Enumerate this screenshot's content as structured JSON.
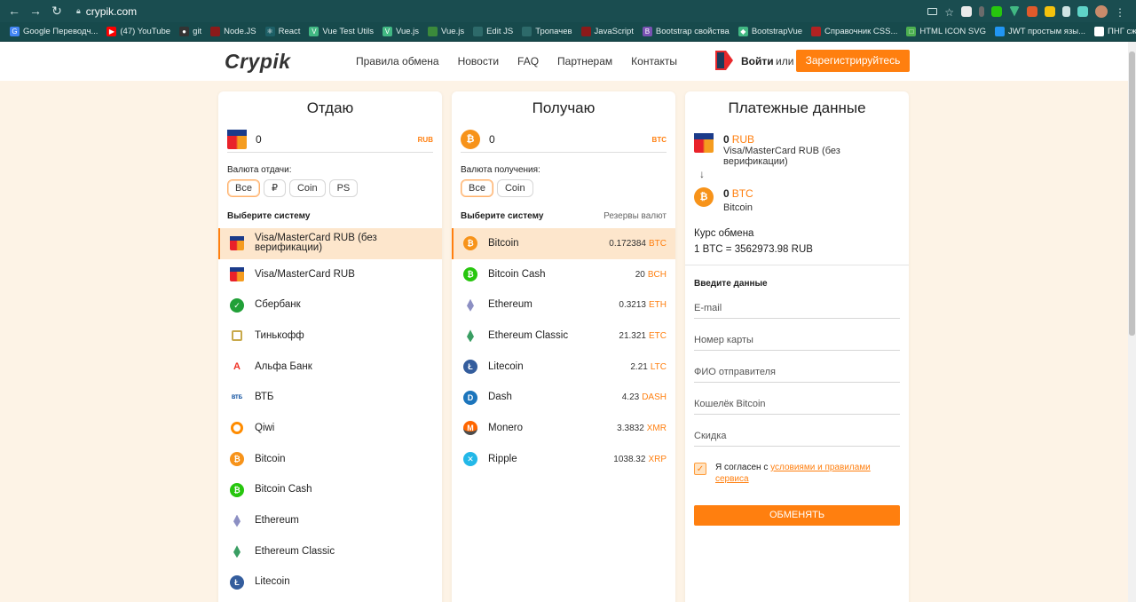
{
  "browser": {
    "url": "crypik.com",
    "bookmarks": [
      {
        "label": "Google Переводч...",
        "color": "#4285f4",
        "icon": "G"
      },
      {
        "label": "(47) YouTube",
        "color": "#ff0000",
        "icon": "▶"
      },
      {
        "label": "git",
        "color": "#333333",
        "icon": "●"
      },
      {
        "label": "Node.JS",
        "color": "#8b1a1a",
        "icon": ""
      },
      {
        "label": "React",
        "color": "#1d5f66",
        "icon": "⚛"
      },
      {
        "label": "Vue Test Utils",
        "color": "#41b883",
        "icon": "V"
      },
      {
        "label": "Vue.js",
        "color": "#41b883",
        "icon": "V"
      },
      {
        "label": "Vue.js",
        "color": "#3b8a3b",
        "icon": ""
      },
      {
        "label": "Edit JS",
        "color": "#2d6a6a",
        "icon": ""
      },
      {
        "label": "Тропачев",
        "color": "#2d6a6a",
        "icon": ""
      },
      {
        "label": "JavaScript",
        "color": "#8b1a1a",
        "icon": ""
      },
      {
        "label": "Bootstrap свойства",
        "color": "#7952b3",
        "icon": "B"
      },
      {
        "label": "BootstrapVue",
        "color": "#41b883",
        "icon": "◆"
      },
      {
        "label": "Справочник CSS...",
        "color": "#b22222",
        "icon": ""
      },
      {
        "label": "HTML ICON SVG",
        "color": "#4caf50",
        "icon": "□"
      },
      {
        "label": "JWT простым язы...",
        "color": "#2196f3",
        "icon": ""
      },
      {
        "label": "ПНГ сжимает в Jpg",
        "color": "#ffffff",
        "icon": ""
      }
    ]
  },
  "header": {
    "logo": "Crypik",
    "menu": [
      "Правила обмена",
      "Новости",
      "FAQ",
      "Партнерам",
      "Контакты"
    ],
    "login": "Войти",
    "or": "или",
    "register": "Зарегистрируйтесь"
  },
  "give": {
    "title": "Отдаю",
    "amount": "0",
    "currency": "RUB",
    "currency_label": "Валюта отдачи:",
    "filters": [
      "Все",
      "₽",
      "Coin",
      "PS"
    ],
    "systems_label": "Выберите систему",
    "items": [
      {
        "name": "Visa/MasterCard RUB (без верификации)",
        "icon": "visa-mastercard-icon"
      },
      {
        "name": "Visa/MasterCard RUB",
        "icon": "visa-mastercard-icon"
      },
      {
        "name": "Сбербанк",
        "icon": "sberbank-icon"
      },
      {
        "name": "Тинькофф",
        "icon": "tinkoff-icon"
      },
      {
        "name": "Альфа Банк",
        "icon": "alfa-bank-icon"
      },
      {
        "name": "ВТБ",
        "icon": "vtb-icon"
      },
      {
        "name": "Qiwi",
        "icon": "qiwi-icon"
      },
      {
        "name": "Bitcoin",
        "icon": "bitcoin-icon"
      },
      {
        "name": "Bitcoin Cash",
        "icon": "bitcoin-cash-icon"
      },
      {
        "name": "Ethereum",
        "icon": "ethereum-icon"
      },
      {
        "name": "Ethereum Classic",
        "icon": "ethereum-classic-icon"
      },
      {
        "name": "Litecoin",
        "icon": "litecoin-icon"
      }
    ]
  },
  "get": {
    "title": "Получаю",
    "amount": "0",
    "currency": "BTC",
    "currency_label": "Валюта получения:",
    "filters": [
      "Все",
      "Coin"
    ],
    "systems_label": "Выберите систему",
    "reserves_label": "Резервы валют",
    "items": [
      {
        "name": "Bitcoin",
        "reserve": "0.172384",
        "code": "BTC",
        "icon": "bitcoin-icon"
      },
      {
        "name": "Bitcoin Cash",
        "reserve": "20",
        "code": "BCH",
        "icon": "bitcoin-cash-icon"
      },
      {
        "name": "Ethereum",
        "reserve": "0.3213",
        "code": "ETH",
        "icon": "ethereum-icon"
      },
      {
        "name": "Ethereum Classic",
        "reserve": "21.321",
        "code": "ETC",
        "icon": "ethereum-classic-icon"
      },
      {
        "name": "Litecoin",
        "reserve": "2.21",
        "code": "LTC",
        "icon": "litecoin-icon"
      },
      {
        "name": "Dash",
        "reserve": "4.23",
        "code": "DASH",
        "icon": "dash-icon"
      },
      {
        "name": "Monero",
        "reserve": "3.3832",
        "code": "XMR",
        "icon": "monero-icon"
      },
      {
        "name": "Ripple",
        "reserve": "1038.32",
        "code": "XRP",
        "icon": "ripple-icon"
      }
    ]
  },
  "payment": {
    "title": "Платежные данные",
    "give_amount": "0",
    "give_code": "RUB",
    "give_name": "Visa/MasterCard RUB (без верификации)",
    "get_amount": "0",
    "get_code": "BTC",
    "get_name": "Bitcoin",
    "rate_label": "Курс обмена",
    "rate_value": "1 BTC = 3562973.98 RUB",
    "enter_label": "Введите данные",
    "fields": [
      "E-mail",
      "Номер карты",
      "ФИО отправителя",
      "Кошелёк Bitcoin",
      "Скидка"
    ],
    "agree_text": "Я согласен с ",
    "agree_link": "условиями и правилами сервиса",
    "submit": "ОБМЕНЯТЬ"
  },
  "colors": {
    "accent": "#ff7f0f",
    "page_bg": "#fdf3e6",
    "chrome": "#1a4d50"
  }
}
